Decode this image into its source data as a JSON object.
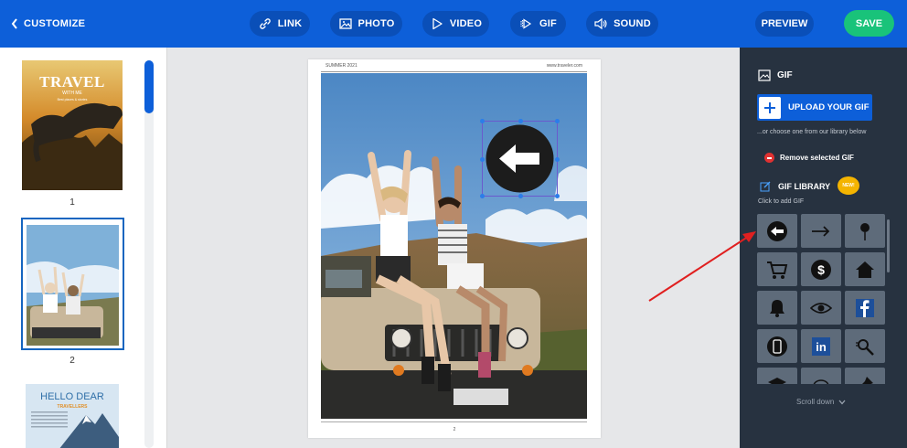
{
  "topbar": {
    "back_label": "CUSTOMIZE",
    "tools": [
      {
        "label": "LINK",
        "icon": "link-icon"
      },
      {
        "label": "PHOTO",
        "icon": "photo-icon"
      },
      {
        "label": "VIDEO",
        "icon": "video-icon"
      },
      {
        "label": "GIF",
        "icon": "gif-icon"
      },
      {
        "label": "SOUND",
        "icon": "sound-icon"
      }
    ],
    "preview_label": "PREVIEW",
    "save_label": "SAVE"
  },
  "thumbnails": {
    "page1": {
      "title": "TRAVEL",
      "subtitle": "WITH ME",
      "tagline": "Best places & stories",
      "number": "1"
    },
    "page2": {
      "number": "2"
    },
    "page3": {
      "title": "HELLO DEAR",
      "subtitle": "TRAVELLERS"
    }
  },
  "page": {
    "header_left": "SUMMER 2021",
    "header_right": "www.traveler.com",
    "page_number": "2"
  },
  "panel": {
    "title": "GIF",
    "upload_label": "UPLOAD YOUR GIF",
    "or_text": "...or choose one from our library below",
    "remove_label": "Remove selected GIF",
    "library_title": "GIF LIBRARY",
    "new_badge": "NEW!",
    "library_sub": "Click to add GIF",
    "scroll_label": "Scroll down",
    "icons": [
      "arrow-left-circle-icon",
      "arrow-right-icon",
      "location-pin-icon",
      "shopping-cart-icon",
      "dollar-circle-icon",
      "house-icon",
      "bell-icon",
      "eye-icon",
      "facebook-icon",
      "smartphone-icon",
      "linkedin-icon",
      "magnifier-icon",
      "graduation-cap-icon",
      "piggy-bank-icon",
      "pushpin-icon"
    ]
  },
  "colors": {
    "topbar": "#0d5fd9",
    "save": "#19c37a",
    "panel": "#273240",
    "tile": "#5e6b7a",
    "selection": "#6a5acd",
    "annotation_arrow": "#e02020"
  }
}
